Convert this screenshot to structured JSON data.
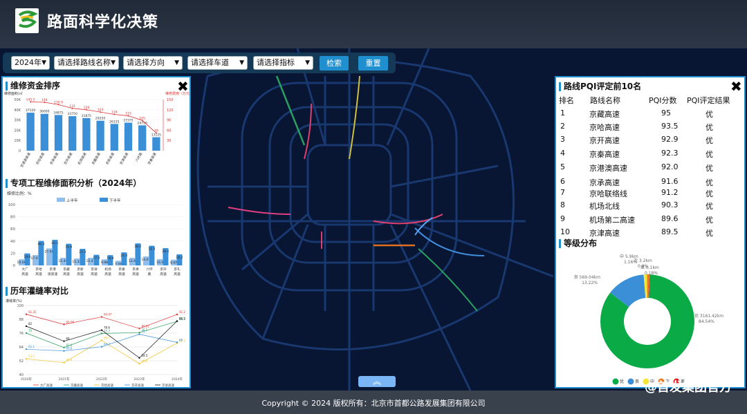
{
  "header": {
    "title": "路面科学化决策",
    "logo_icon": "sfjt-logo-icon"
  },
  "toolbar": {
    "year": "2024年",
    "route": "请选择路线名称",
    "direction": "请选择方向",
    "lane": "请选择车道",
    "index": "请选择指标",
    "search_label": "检索",
    "reset_label": "重置"
  },
  "panel_funds": {
    "title": "维修资金排序",
    "close": "✖",
    "left_axis_label": "维修面积/㎡",
    "right_axis_label": "维修费用（万元）",
    "chart_data": {
      "type": "bar",
      "ylim": [
        0,
        50000
      ],
      "y2lim": [
        40,
        150
      ],
      "yticks": [
        "50K",
        "40K",
        "30K",
        "20K",
        "10K",
        "0"
      ],
      "y2ticks": [
        "150",
        "120",
        "90",
        "60",
        "30"
      ],
      "categories": [
        "京港澳高速",
        "京哈高速",
        "京承高速",
        "京开高速",
        "机场高速",
        "京藏高速",
        "京新高速",
        "京津高速",
        "六环路",
        "京秦高速"
      ],
      "values": [
        37120,
        36000,
        34875,
        33750,
        31875,
        29250,
        26125,
        27375,
        24750,
        13125
      ],
      "line_values": [
        145,
        144,
        139,
        131,
        128,
        123,
        118,
        115,
        105,
        78
      ],
      "line_labels": [
        "145.5",
        "144",
        "139.9",
        "131",
        "128",
        "123",
        "118",
        "115",
        "105",
        "78"
      ]
    }
  },
  "panel_area": {
    "title": "专项工程维修面积分析（2024年）",
    "unit_label": "维修比例：%",
    "legend": [
      "上半年",
      "下半年"
    ],
    "chart_data": {
      "type": "bar",
      "ylim": [
        0,
        100
      ],
      "yticks": [
        "100",
        "80",
        "60",
        "40",
        "20",
        "0"
      ],
      "categories": [
        "大广高速",
        "京哈高速",
        "京港澳高速",
        "京藏高速",
        "京新高速",
        "京津高速",
        "机场高速",
        "京秦高速",
        "京承高速",
        "六环路",
        "京开高速",
        "京礼高速"
      ],
      "series": [
        {
          "name": "上半年",
          "values": [
            10.06,
            17.01,
            27.98,
            12.45,
            11.32,
            12.47,
            9.98,
            7.59,
            12.4,
            14.67,
            10.3,
            9.47
          ]
        },
        {
          "name": "下半年",
          "values": [
            19.6,
            40.3,
            42.1,
            35.6,
            27.3,
            17.5,
            16.9,
            21.4,
            36.2,
            32.3,
            28.4,
            18.2
          ]
        }
      ]
    }
  },
  "panel_cracks": {
    "title": "历年灌缝率对比",
    "unit_label": "灌缝率(%)",
    "chart_data": {
      "type": "line",
      "ylim": [
        40,
        100
      ],
      "yticks": [
        "100",
        "88",
        "76",
        "64",
        "52",
        "40"
      ],
      "categories": [
        "2020年",
        "2021年",
        "2022年",
        "2023年",
        "2024年"
      ],
      "series": [
        {
          "name": "大广高速",
          "values": [
            92.35,
            83.58,
            90.07,
            80.02,
            92.2
          ]
        },
        {
          "name": "京藏高速",
          "values": [
            76,
            63.5,
            75.7,
            76.5,
            86.2
          ]
        },
        {
          "name": "京哈高速",
          "values": [
            53.7,
            50.4,
            69.7,
            49.5,
            67.4
          ]
        },
        {
          "name": "京开高速",
          "values": [
            62.1,
            60.6,
            64.2,
            75.0,
            68.0
          ]
        },
        {
          "name": "京承高速",
          "values": [
            82.0,
            69.0,
            78.6,
            54.5,
            86.5
          ]
        }
      ]
    }
  },
  "panel_pqi": {
    "title": "路线PQI评定前10名",
    "close": "✖",
    "headers": [
      "排名",
      "路线名称",
      "PQI分数",
      "PQI评定结果"
    ],
    "rows": [
      [
        "1",
        "京藏高速",
        "95",
        "优"
      ],
      [
        "2",
        "京哈高速",
        "93.5",
        "优"
      ],
      [
        "3",
        "京开高速",
        "92.9",
        "优"
      ],
      [
        "4",
        "京秦高速",
        "92.3",
        "优"
      ],
      [
        "5",
        "京港澳高速",
        "92.0",
        "优"
      ],
      [
        "6",
        "京承高速",
        "91.6",
        "优"
      ],
      [
        "7",
        "京哈联络线",
        "91.2",
        "优"
      ],
      [
        "8",
        "机场北线",
        "90.3",
        "优"
      ],
      [
        "9",
        "机场第二高速",
        "89.6",
        "优"
      ],
      [
        "10",
        "京津高速",
        "89.5",
        "优"
      ]
    ]
  },
  "panel_grade": {
    "title": "等级分布",
    "chart_data": {
      "type": "pie",
      "slices": [
        {
          "name": "优",
          "value": 84.54,
          "label": "优 3161.42km",
          "pct": "84.54%",
          "color": "#0aaa47"
        },
        {
          "name": "良",
          "value": 13.22,
          "label": "良 569.04km",
          "pct": "13.22%",
          "color": "#3a8fd7"
        },
        {
          "name": "中",
          "value": 1.16,
          "label": "中 5.9km",
          "pct": "1.16%",
          "color": "#f5e53a"
        },
        {
          "name": "次",
          "value": 0.9,
          "label": "次 3.2km",
          "pct": "0.9%",
          "color": "#e87a20"
        },
        {
          "name": "差",
          "value": 0.18,
          "label": "差 0.1km",
          "pct": "0.18%",
          "color": "#e02020"
        }
      ]
    }
  },
  "footer": {
    "copyright": "Copyright © 2024 版权所有：北京市首都公路发展集团有限公司"
  },
  "watermark": "@首发集团官方"
}
